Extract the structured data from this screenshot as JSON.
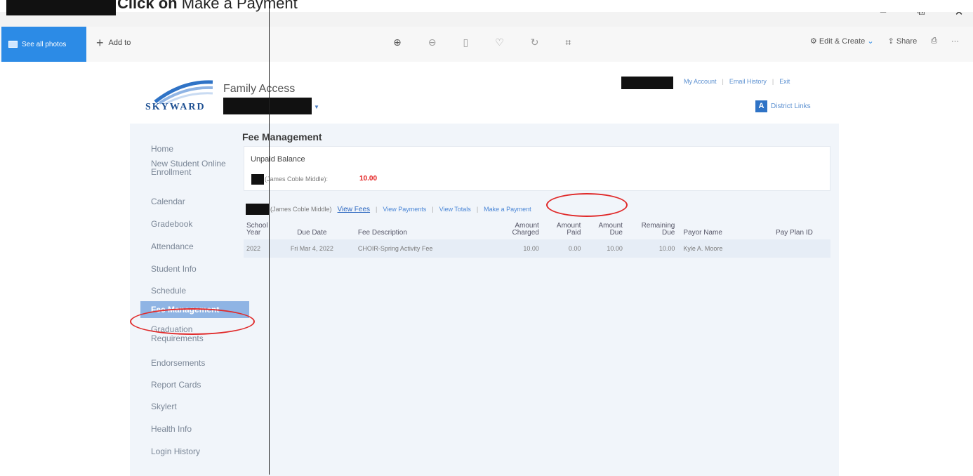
{
  "caption": {
    "prefix": "Click on ",
    "action": "Make a Payment"
  },
  "window": {
    "minimize": "–",
    "restore": "⧉",
    "close": "✕"
  },
  "toolbar": {
    "see_all": "See all photos",
    "add_to": "Add to",
    "icons": [
      "zoom-in-icon",
      "zoom-out-icon",
      "delete-icon",
      "favorite-icon",
      "rotate-icon",
      "crop-icon"
    ],
    "edit_create": "Edit & Create",
    "share": "Share",
    "print_icon": "print-icon",
    "more": "···"
  },
  "skyward": {
    "logo": "SKYWARD",
    "app_title": "Family Access",
    "top_links": [
      "My Account",
      "Email History",
      "Exit"
    ],
    "district_links": "District Links"
  },
  "sidebar": {
    "items": [
      "Home",
      "New Student Online Enrollment",
      "Calendar",
      "Gradebook",
      "Attendance",
      "Student Info",
      "Schedule",
      "Fee Management",
      "Graduation Requirements",
      "Endorsements",
      "Report Cards",
      "Skylert",
      "Health Info",
      "Login History"
    ],
    "active_index": 7
  },
  "main": {
    "title": "Fee Management",
    "unpaid": {
      "title": "Unpaid Balance",
      "school": "(James Coble Middle):",
      "amount": "10.00"
    },
    "links": {
      "school": "(James Coble Middle)",
      "view_fees": "View Fees",
      "view_payments": "View Payments",
      "view_totals": "View Totals",
      "make_payment": "Make a Payment"
    },
    "table": {
      "headers": [
        "School Year",
        "Due Date",
        "Fee Description",
        "Amount Charged",
        "Amount Paid",
        "Amount Due",
        "Remaining Due",
        "Payor Name",
        "Pay Plan ID"
      ],
      "rows": [
        [
          "2022",
          "Fri Mar 4, 2022",
          "CHOIR-Spring Activity Fee",
          "10.00",
          "0.00",
          "10.00",
          "10.00",
          "Kyle A. Moore",
          ""
        ]
      ]
    }
  },
  "colors": {
    "accent": "#2c8be6",
    "annotation": "#e02a2a",
    "balance": "#e31b1b",
    "active_nav": "#8fb4e4"
  }
}
